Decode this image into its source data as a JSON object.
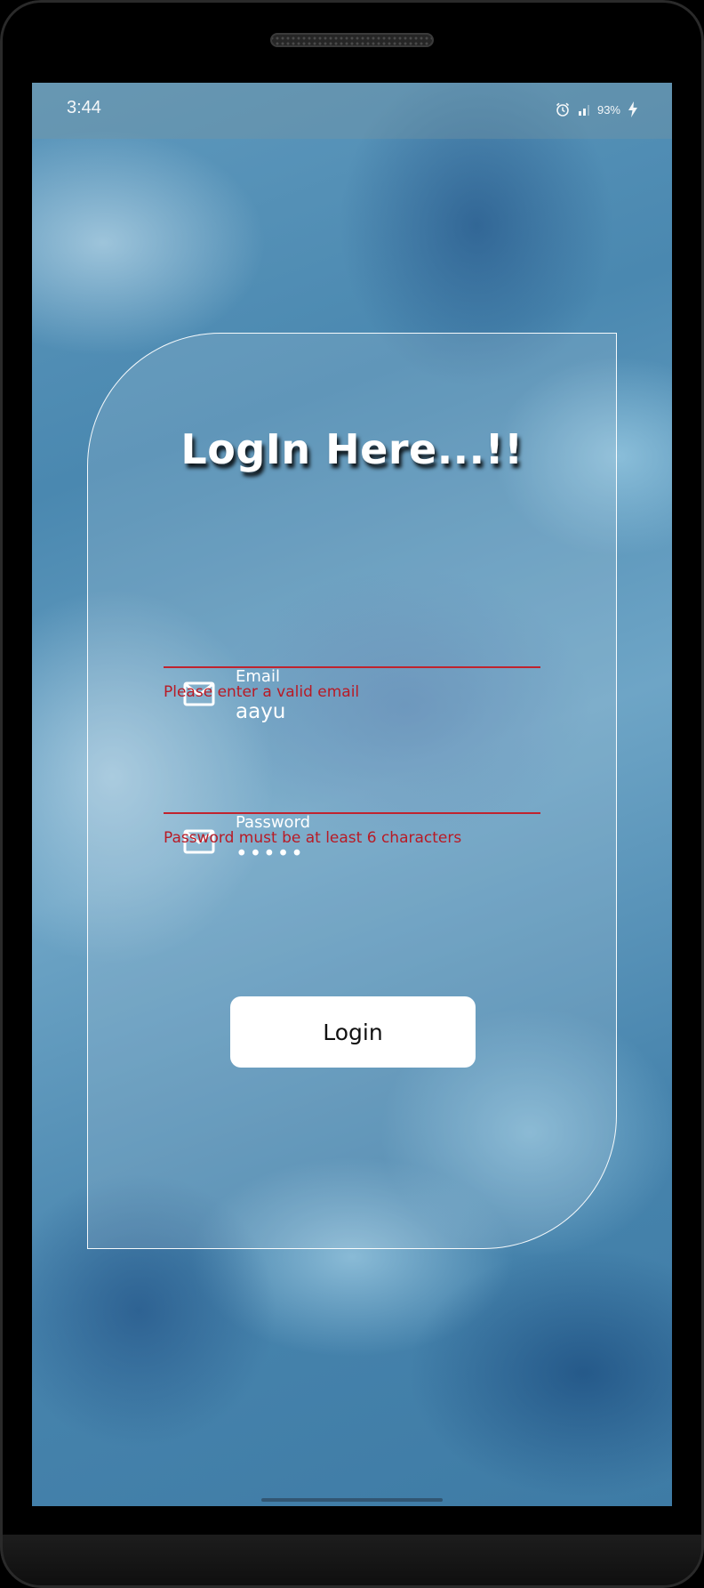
{
  "status_bar": {
    "time": "3:44",
    "battery": "93%",
    "icons": [
      "alarm-icon",
      "signal-icon",
      "charging-icon"
    ]
  },
  "login": {
    "title": "LogIn Here...!!",
    "email": {
      "label": "Email",
      "value": "aayu",
      "error": "Please enter a valid email",
      "icon": "mail-icon"
    },
    "password": {
      "label": "Password",
      "value": "•••••",
      "error": "Password must be at least 6 characters",
      "icon": "mail-icon"
    },
    "button_label": "Login"
  },
  "colors": {
    "error": "#b81a25",
    "panel_border": "#ffffff",
    "button_bg": "#ffffff",
    "text": "#ffffff"
  }
}
